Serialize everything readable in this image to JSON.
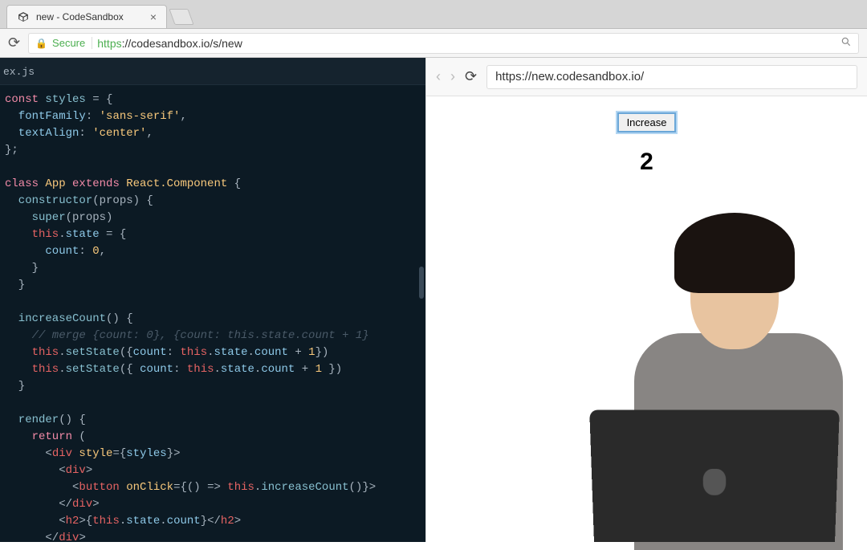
{
  "chrome": {
    "tab_title": "new - CodeSandbox",
    "secure_label": "Secure",
    "url_protocol": "https",
    "url_rest": "://codesandbox.io/s/new"
  },
  "editor": {
    "file_tab": "ex.js",
    "code": {
      "l1_const": "const",
      "l1_var": " styles ",
      "l1_eq": "= {",
      "l2_prop": "  fontFamily",
      "l2_punct": ": ",
      "l2_str": "'sans-serif'",
      "l2_end": ",",
      "l3_prop": "  textAlign",
      "l3_punct": ": ",
      "l3_str": "'center'",
      "l3_end": ",",
      "l4": "};",
      "l6_class": "class",
      "l6_name": " App ",
      "l6_ext": "extends",
      "l6_react": " React.Component ",
      "l6_open": "{",
      "l7_name": "  constructor",
      "l7_args": "(props) {",
      "l8_super": "    super",
      "l8_args": "(props)",
      "l9_this": "    this",
      "l9_dot": ".",
      "l9_state": "state",
      "l9_eq": " = {",
      "l10_prop": "      count",
      "l10_val": ": ",
      "l10_num": "0",
      "l10_end": ",",
      "l11": "    }",
      "l12": "  }",
      "l14_name": "  increaseCount",
      "l14_args": "() {",
      "l15_comment": "    // merge {count: 0}, {count: this.state.count + 1}",
      "l16_this": "    this",
      "l16_dot": ".",
      "l16_fn": "setState",
      "l16_open": "({",
      "l16_prop": "count",
      "l16_colon": ": ",
      "l16_this2": "this",
      "l16_dot2": ".",
      "l16_state": "state",
      "l16_dot3": ".",
      "l16_count": "count",
      "l16_plus": " + ",
      "l16_one": "1",
      "l16_close": "})",
      "l17_this": "    this",
      "l17_dot": ".",
      "l17_fn": "setState",
      "l17_open": "({ ",
      "l17_prop": "count",
      "l17_colon": ": ",
      "l17_this2": "this",
      "l17_dot2": ".",
      "l17_state": "state",
      "l17_dot3": ".",
      "l17_count": "count",
      "l17_plus": " + ",
      "l17_one": "1",
      "l17_close": " })",
      "l18": "  }",
      "l20_name": "  render",
      "l20_args": "() {",
      "l21_ret": "    return",
      "l21_open": " (",
      "l22_open": "      <",
      "l22_tag": "div",
      "l22_attr": " style",
      "l22_eq": "=",
      "l22_brace": "{",
      "l22_var": "styles",
      "l22_brace2": "}",
      "l22_gt": ">",
      "l23_open": "        <",
      "l23_tag": "div",
      "l23_gt": ">",
      "l24_open": "          <",
      "l24_tag": "button",
      "l24_attr": " onClick",
      "l24_eq": "=",
      "l24_brace": "{",
      "l24_arrow": "() => ",
      "l24_this": "this",
      "l24_dot": ".",
      "l24_fn": "increaseCount",
      "l24_call": "()}>",
      "l25_open": "        </",
      "l25_tag": "div",
      "l25_gt": ">",
      "l26_open": "        <",
      "l26_tag": "h2",
      "l26_gt": ">",
      "l26_brace": "{",
      "l26_this": "this",
      "l26_dot": ".",
      "l26_state": "state",
      "l26_dot2": ".",
      "l26_count": "count",
      "l26_brace2": "}",
      "l26_close": "</",
      "l26_tag2": "h2",
      "l26_gt2": ">",
      "l27_open": "      </",
      "l27_tag": "div",
      "l27_gt": ">"
    }
  },
  "preview": {
    "url": "https://new.codesandbox.io/",
    "button_label": "Increase",
    "count_value": "2"
  }
}
